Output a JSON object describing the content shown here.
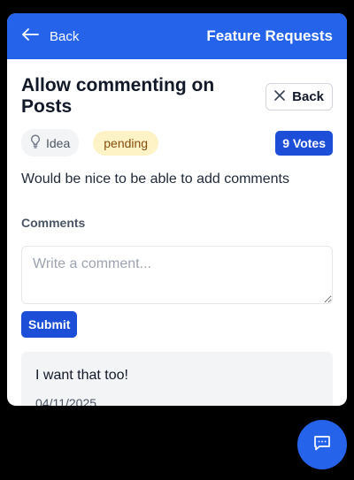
{
  "header": {
    "back_label": "Back",
    "title": "Feature Requests",
    "background": "#2563eb"
  },
  "request": {
    "title": "Allow commenting on Posts",
    "close_label": "Back",
    "category": "Idea",
    "status": "pending",
    "votes_label": "9 Votes",
    "description": "Would be nice to be able to add comments"
  },
  "comments": {
    "section_label": "Comments",
    "placeholder": "Write a comment...",
    "submit_label": "Submit",
    "items": [
      {
        "text": "I want that too!",
        "date": "04/11/2025"
      }
    ]
  },
  "icons": {
    "header_back": "arrow-left-icon",
    "close": "x-icon",
    "category": "lightbulb-icon",
    "fab": "chat-bubble-icon"
  }
}
